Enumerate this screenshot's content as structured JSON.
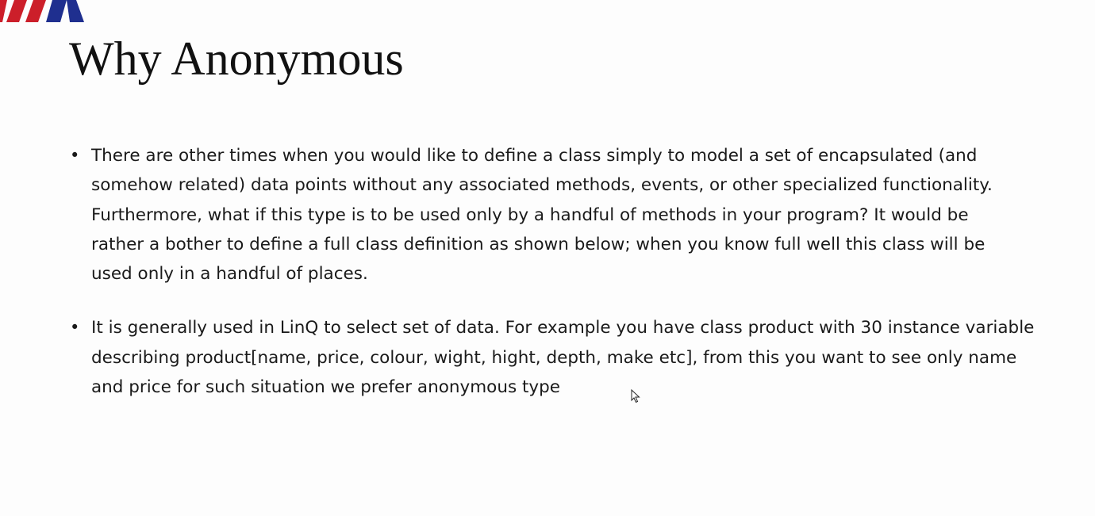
{
  "slide": {
    "title": "Why Anonymous",
    "logo": {
      "icon": "flag-stripes-logo",
      "colors": [
        "#cc1f2a",
        "#1f2f8f"
      ]
    },
    "bullets": [
      {
        "lines": [
          "There are other times when you would like to define a class simply to model a set of encapsulated (and",
          "somehow related) data points without any associated methods, events, or other specialized functionality.",
          "Furthermore, what if this type is to be used only by a handful of methods in your program? It would be",
          "rather a bother to define a full class definition as shown below; when you know full well this class will be",
          "used only in a handful of places."
        ]
      },
      {
        "lines": [
          "It is generally used in LinQ to select set of data. For example you have class product with 30 instance variable",
          "describing product[name, price, colour, wight, hight, depth, make etc], from this you want to see only name",
          "and price for such situation we prefer anonymous type"
        ]
      }
    ]
  },
  "cursor": {
    "icon": "mouse-pointer-icon"
  }
}
